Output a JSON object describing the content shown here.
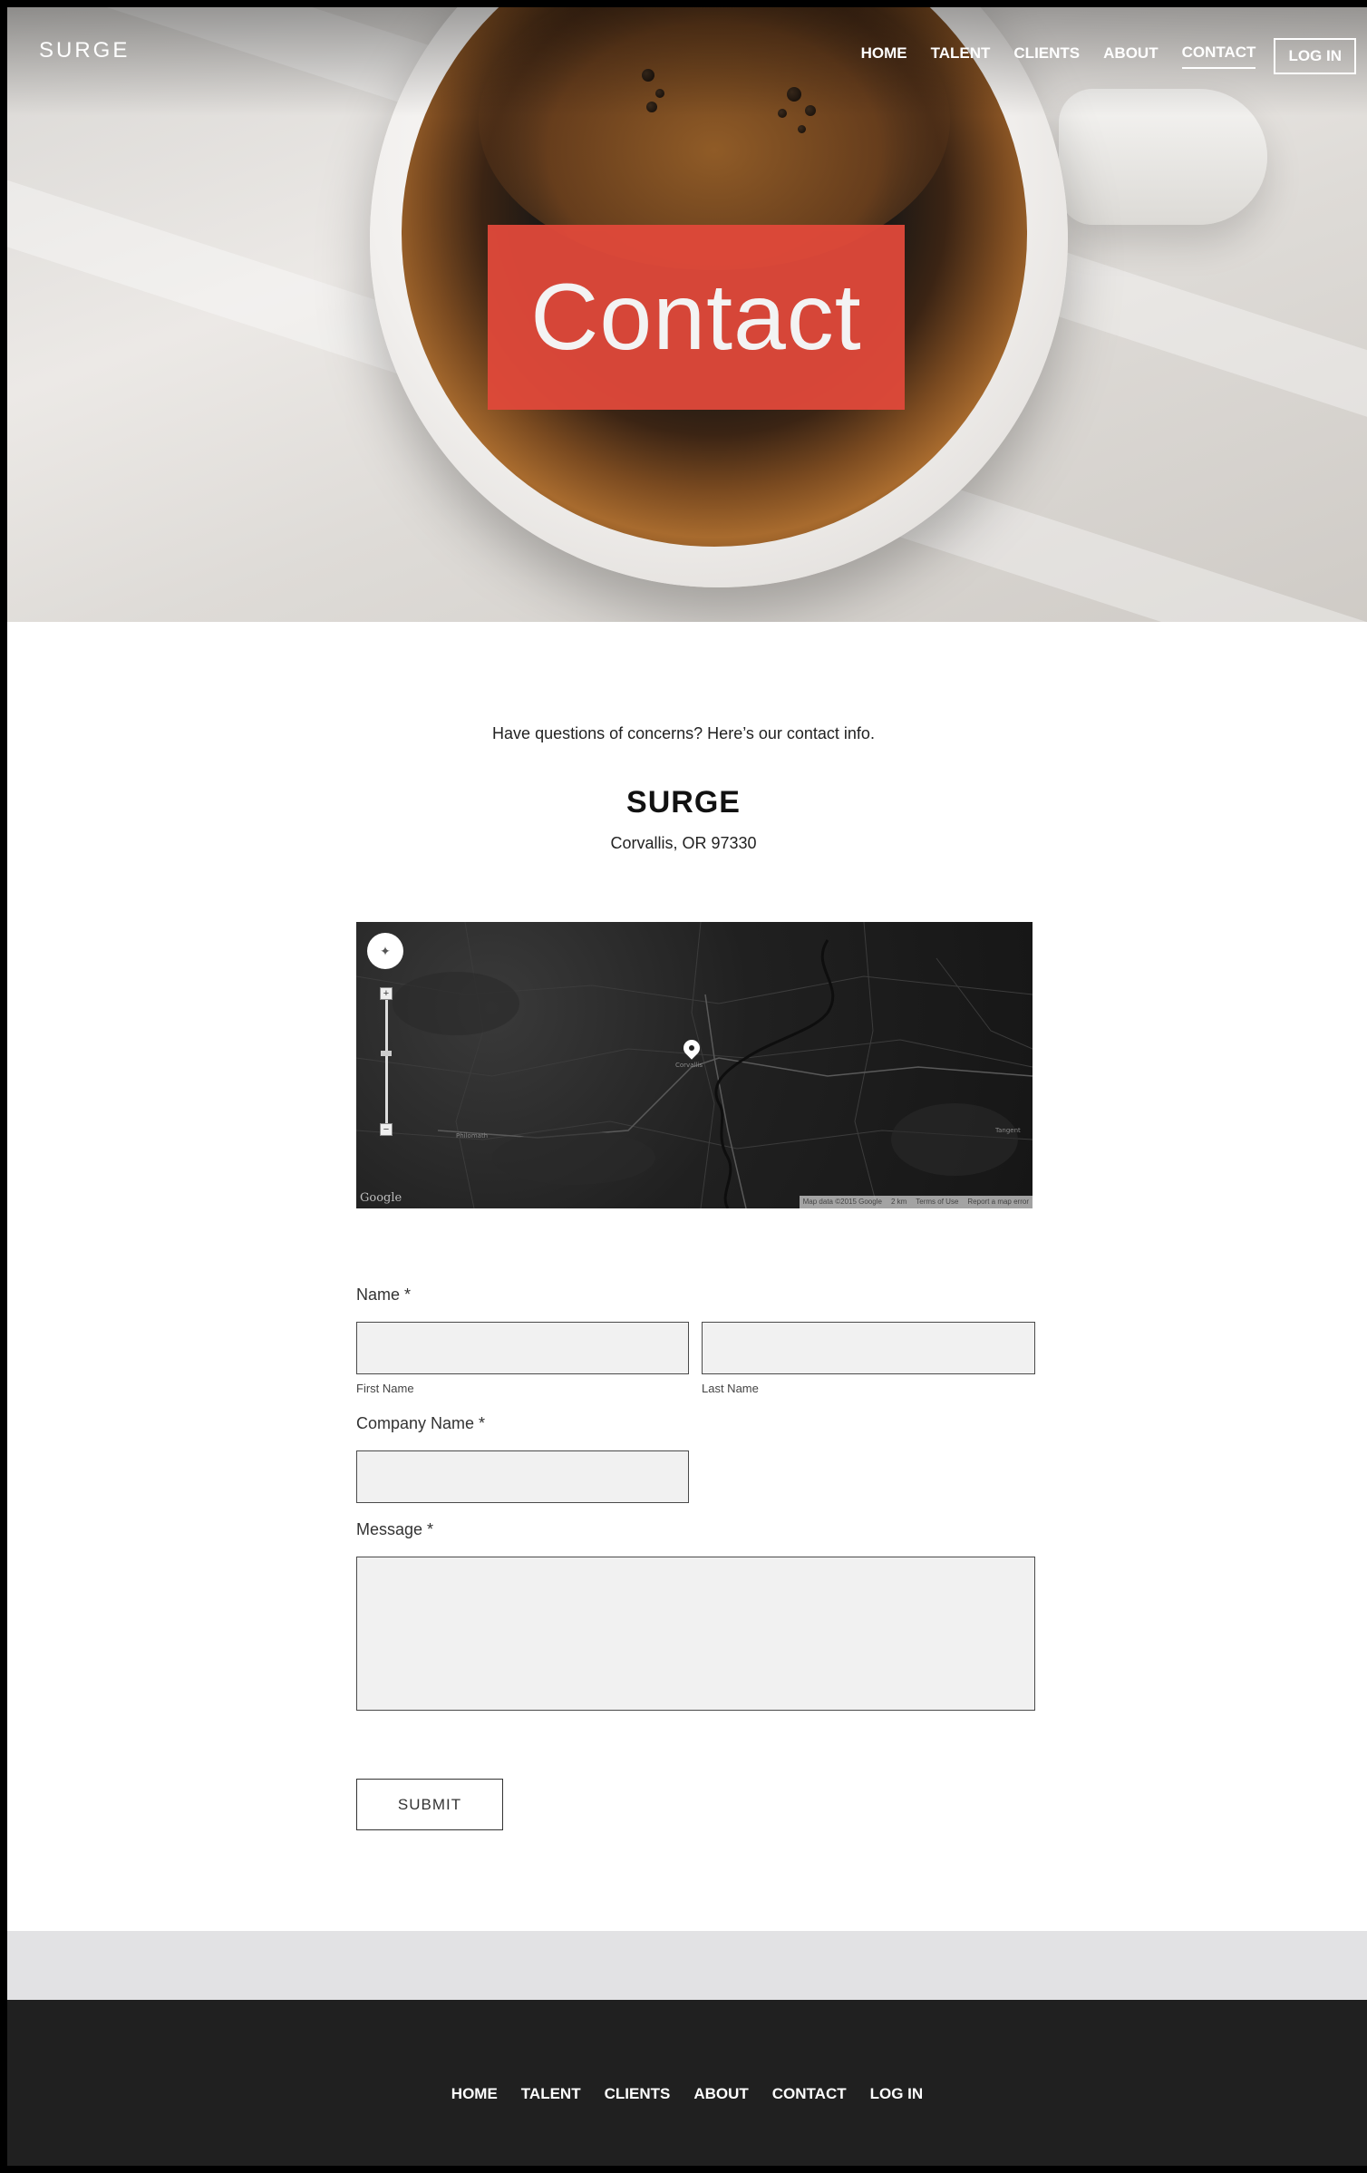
{
  "brand": "SURGE",
  "nav": {
    "items": [
      {
        "label": "HOME"
      },
      {
        "label": "TALENT"
      },
      {
        "label": "CLIENTS"
      },
      {
        "label": "ABOUT"
      },
      {
        "label": "CONTACT",
        "active": true
      }
    ],
    "login_label": "LOG IN"
  },
  "hero": {
    "title": "Contact",
    "title_bg_color": "#e0493a"
  },
  "contact": {
    "intro": "Have questions of concerns? Here’s our contact info.",
    "company": "SURGE",
    "address": "Corvallis, OR 97330"
  },
  "map": {
    "logo": "Google",
    "attribution": [
      "Map data ©2015 Google",
      "2 km",
      "Terms of Use",
      "Report a map error"
    ],
    "place_labels": [
      "Corvallis",
      "Philomath",
      "Tangent"
    ]
  },
  "form": {
    "name_label": "Name *",
    "first_name_sublabel": "First Name",
    "last_name_sublabel": "Last Name",
    "company_label": "Company Name *",
    "message_label": "Message *",
    "submit_label": "SUBMIT",
    "values": {
      "first_name": "",
      "last_name": "",
      "company": "",
      "message": ""
    }
  },
  "footer": {
    "items": [
      {
        "label": "HOME"
      },
      {
        "label": "TALENT"
      },
      {
        "label": "CLIENTS"
      },
      {
        "label": "ABOUT"
      },
      {
        "label": "CONTACT"
      },
      {
        "label": "LOG IN"
      }
    ]
  },
  "colors": {
    "accent": "#e0493a",
    "footer_bg": "#202020",
    "band_bg": "#e2e2e4",
    "field_bg": "#f1f1f1"
  }
}
